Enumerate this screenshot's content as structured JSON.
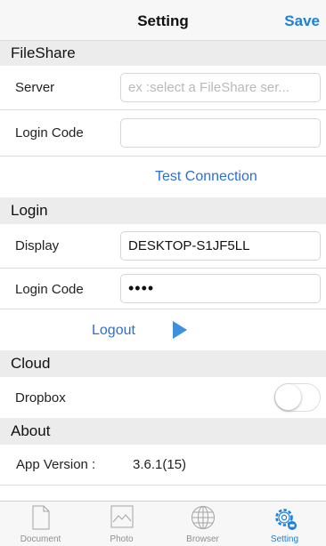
{
  "navbar": {
    "title": "Setting",
    "save_label": "Save"
  },
  "fileshare": {
    "header": "FileShare",
    "server_label": "Server",
    "server_placeholder": "ex :select a FileShare ser...",
    "login_code_label": "Login Code",
    "login_code_value": "",
    "test_connection_label": "Test Connection"
  },
  "login": {
    "header": "Login",
    "display_label": "Display",
    "display_value": "DESKTOP-S1JF5LL",
    "login_code_label": "Login Code",
    "login_code_value": "••••",
    "logout_label": "Logout"
  },
  "cloud": {
    "header": "Cloud",
    "dropbox_label": "Dropbox",
    "dropbox_enabled": false
  },
  "about": {
    "header": "About",
    "app_version_label": "App Version :",
    "app_version_value": "3.6.1(15)"
  },
  "tabbar": {
    "tabs": [
      {
        "label": "Document",
        "icon": "document-icon",
        "active": false
      },
      {
        "label": "Photo",
        "icon": "photo-icon",
        "active": false
      },
      {
        "label": "Browser",
        "icon": "globe-icon",
        "active": false
      },
      {
        "label": "Setting",
        "icon": "gear-icon",
        "active": true
      }
    ]
  },
  "colors": {
    "accent": "#1e7fd6",
    "link": "#2e6fcf",
    "section_bg": "#ececec",
    "play": "#3d8fe0"
  }
}
